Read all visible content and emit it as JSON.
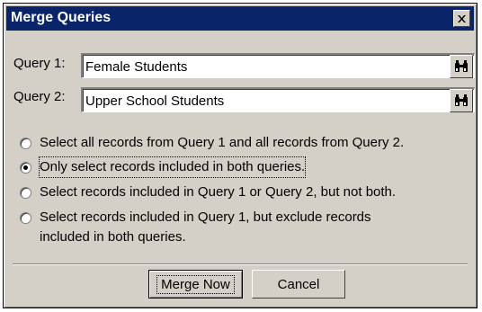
{
  "dialog": {
    "title": "Merge Queries",
    "close_icon": "close-icon"
  },
  "query1": {
    "label": "Query 1:",
    "value": "Female Students",
    "find_icon": "binoculars-icon"
  },
  "query2": {
    "label": "Query 2:",
    "value": "Upper School Students",
    "find_icon": "binoculars-icon"
  },
  "options": [
    {
      "label": "Select all records from Query 1 and all records from Query 2.",
      "selected": false
    },
    {
      "label": "Only select records included in both queries.",
      "selected": true
    },
    {
      "label": "Select records included in Query 1 or Query 2, but not both.",
      "selected": false
    },
    {
      "label": "Select records included in Query 1, but exclude records",
      "label_line2": "included in both queries.",
      "selected": false
    }
  ],
  "buttons": {
    "merge_label": "Merge Now",
    "cancel_label": "Cancel"
  }
}
